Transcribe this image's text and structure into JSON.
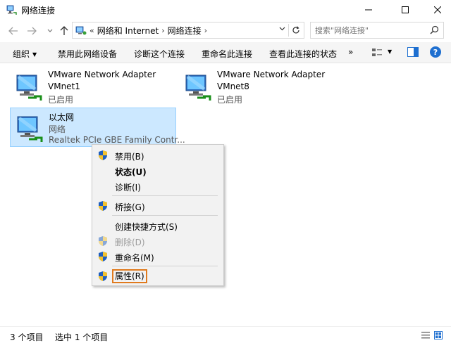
{
  "window": {
    "title": "网络连接"
  },
  "address": {
    "overflow": "«",
    "crumbs": [
      "网络和 Internet",
      "网络连接"
    ],
    "search_placeholder": "搜索\"网络连接\""
  },
  "toolbar": {
    "organize": "组织",
    "disable": "禁用此网络设备",
    "diagnose": "诊断这个连接",
    "rename": "重命名此连接",
    "view_status": "查看此连接的状态",
    "more": "»"
  },
  "adapters": [
    {
      "name": "VMware Network Adapter",
      "line2": "VMnet1",
      "line3": "已启用",
      "selected": false
    },
    {
      "name": "VMware Network Adapter",
      "line2": "VMnet8",
      "line3": "已启用",
      "selected": false
    },
    {
      "name": "以太网",
      "line2": "网络",
      "line3": "Realtek PCIe GBE Family Contr...",
      "selected": true
    }
  ],
  "context_menu": {
    "items": [
      {
        "label": "禁用(B)",
        "shield": true,
        "bold": false,
        "disabled": false
      },
      {
        "label": "状态(U)",
        "shield": false,
        "bold": true,
        "disabled": false
      },
      {
        "label": "诊断(I)",
        "shield": false,
        "bold": false,
        "disabled": false
      },
      {
        "label": "桥接(G)",
        "shield": true,
        "bold": false,
        "disabled": false
      },
      {
        "label": "创建快捷方式(S)",
        "shield": false,
        "bold": false,
        "disabled": false
      },
      {
        "label": "删除(D)",
        "shield": true,
        "bold": false,
        "disabled": true
      },
      {
        "label": "重命名(M)",
        "shield": true,
        "bold": false,
        "disabled": false
      },
      {
        "label": "属性(R)",
        "shield": true,
        "bold": false,
        "disabled": false,
        "highlighted": true
      }
    ]
  },
  "status": {
    "item_count": "3 个项目",
    "selected_count": "选中 1 个项目"
  },
  "colors": {
    "selection_bg": "#cce8ff",
    "highlight_border": "#e07a1e"
  }
}
